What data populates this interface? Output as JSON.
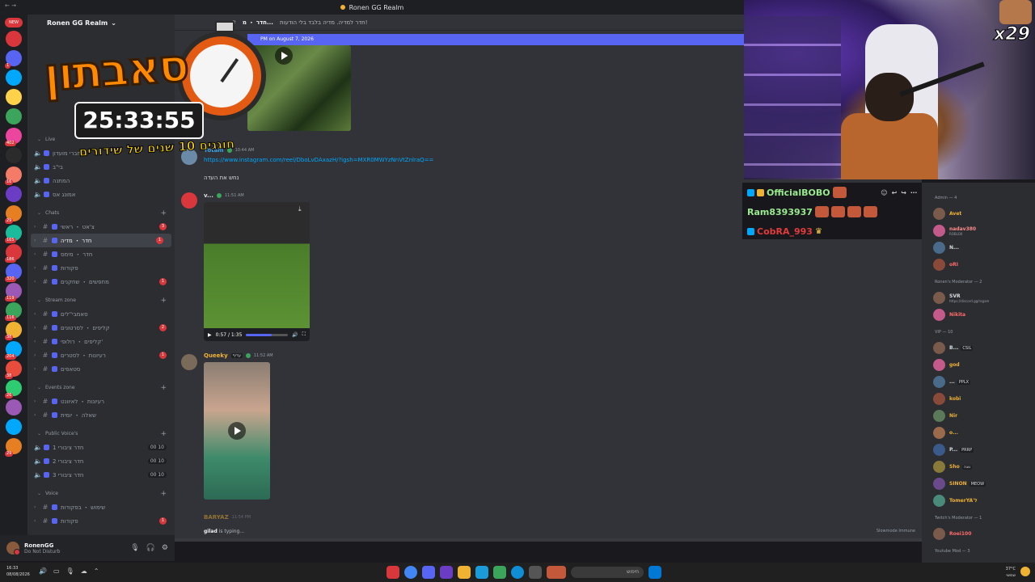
{
  "window": {
    "title": "Ronen GG Realm",
    "back_fwd": "← →"
  },
  "rail": {
    "new_label": "NEW",
    "servers": [
      {
        "color": "#da373c",
        "badge": ""
      },
      {
        "color": "#5865f2",
        "badge": "1"
      },
      {
        "color": "#00a8fc",
        "badge": ""
      },
      {
        "color": "#ffd24a",
        "badge": ""
      },
      {
        "color": "#3ba55c",
        "badge": ""
      },
      {
        "color": "#eb459e",
        "badge": "402"
      },
      {
        "color": "#2b2b2b",
        "badge": ""
      },
      {
        "color": "#f47b67",
        "badge": "16"
      },
      {
        "color": "#6a3dc4",
        "badge": ""
      },
      {
        "color": "#e67e22",
        "badge": "29"
      },
      {
        "color": "#1abc9c",
        "badge": "165"
      },
      {
        "color": "#da373c",
        "badge": "186"
      },
      {
        "color": "#5865f2",
        "badge": "320"
      },
      {
        "color": "#9b59b6",
        "badge": "119"
      },
      {
        "color": "#3ba55c",
        "badge": "116"
      },
      {
        "color": "#f0b232",
        "badge": "38"
      },
      {
        "color": "#00a8fc",
        "badge": "204"
      },
      {
        "color": "#e74c3c",
        "badge": "38"
      },
      {
        "color": "#2ecc71",
        "badge": "26"
      },
      {
        "color": "#9b59b6",
        "badge": ""
      },
      {
        "color": "#00a8fc",
        "badge": ""
      },
      {
        "color": "#e67e22",
        "badge": "29"
      }
    ]
  },
  "sidebar": {
    "guild_name": "Ronen GG Realm",
    "live_label": "Live",
    "channels_top": [
      {
        "label": "חברי מועדון",
        "voice": true
      },
      {
        "label": "בי\"ב",
        "voice": true
      },
      {
        "label": "המתנה",
        "voice": true
      },
      {
        "label": "אמונג אס",
        "voice": true
      }
    ],
    "cat_chats": "Chats",
    "channels_chats": [
      {
        "label": "צ'אט ・ ראשי",
        "badge": "3",
        "active": false
      },
      {
        "label": "חדר ・ מדיה",
        "badge": "1",
        "active": true
      },
      {
        "label": "חדר ・ מימס",
        "badge": "",
        "active": false
      },
      {
        "label": "פקודות",
        "badge": "",
        "active": false
      },
      {
        "label": "מחפשים ・ שחקנים",
        "badge": "1",
        "active": false
      }
    ],
    "cat_stream": "Stream zone",
    "channels_stream": [
      {
        "label": "סאמבי''לים",
        "badge": ""
      },
      {
        "label": "קליפים ・ לסרטונים",
        "badge": "2"
      },
      {
        "label": "קליפים ・ רולופי'",
        "badge": ""
      },
      {
        "label": "רעיונות ・ לסטרים",
        "badge": "1"
      },
      {
        "label": "סטאפים",
        "badge": ""
      }
    ],
    "cat_events": "Events zone",
    "channels_events": [
      {
        "label": "רעיונות ・ לאיוונט",
        "badge": ""
      },
      {
        "label": "שאלה ・ יומית",
        "badge": ""
      }
    ],
    "cat_public_voice": "Public Voice's",
    "channels_public_voice": [
      {
        "label": "חדר ציבורי 1",
        "count": "00 10"
      },
      {
        "label": "חדר ציבורי 2",
        "count": "00 10"
      },
      {
        "label": "חדר ציבורי 3",
        "count": "00 10"
      }
    ],
    "cat_voice": "Voice",
    "channels_voice": [
      {
        "label": "שימוש ・ בפקודות",
        "badge": ""
      },
      {
        "label": "פקודות",
        "badge": "1"
      }
    ]
  },
  "user_panel": {
    "name": "RonenGG",
    "status": "Do Not Disturb",
    "mic_icon": "🎙",
    "headset_icon": "🎧",
    "settings_icon": "⚙"
  },
  "overlay": {
    "title": "סאבתון",
    "timer": "25:33:55",
    "subtitle": "חוגגים 10 שנים של שידורים"
  },
  "chat": {
    "channel_name": "חדר ・ מ...",
    "topic": "חדר למדיה. מדיה בלבד בלי הודעות!",
    "new_messages_bar": "PM on August 7, 2026",
    "messages": [
      {
        "author": "Yotam",
        "color": "#3ba5e6",
        "time": "10:44 AM",
        "link": "https://www.instagram.com/reel/DboLvDAxazH/?igsh=MXR0MWYzNnVtZnlraQ==",
        "text": "נחש את העדה"
      },
      {
        "author": "v...",
        "color": "#dbdee1",
        "time": "11:51 AM",
        "video_time": "0:57 / 1:35",
        "video_progress": 0.6
      },
      {
        "author": "Queeky",
        "color": "#f0b232",
        "time": "11:52 AM",
        "tag": "עדיף"
      },
      {
        "author": "BARYAZ",
        "color": "#f0b232",
        "time": "11:54 PM"
      }
    ],
    "typing_user": "gilad",
    "typing_suffix": " is typing...",
    "slowmode": "Slowmode Immune",
    "composer_plus": "+"
  },
  "webcam": {
    "sub_multiplier": "x29"
  },
  "twitch_chat": {
    "rows": [
      {
        "user": "OfficialBOBO",
        "color": "#9aea8f"
      },
      {
        "user": "Ram8393937",
        "color": "#9aea8f"
      },
      {
        "user": "CobRA_993",
        "color": "#e33b3b"
      }
    ]
  },
  "members": {
    "cat_admin": "Admin — 4",
    "admins": [
      {
        "name": "Avet",
        "color": "#f0b232",
        "sub": ""
      },
      {
        "name": "nadav380",
        "color": "#ff8a8a",
        "sub": "ROBLOX"
      },
      {
        "name": "N...",
        "color": "#dbdee1",
        "sub": ""
      },
      {
        "name": "oRI",
        "color": "#ff6b6b",
        "sub": ""
      }
    ],
    "cat_mod": "Ronen's Moderator — 2",
    "mods": [
      {
        "name": "SVR",
        "color": "#dbdee1",
        "sub": "https://discord.gg/rogam"
      },
      {
        "name": "Nikita",
        "color": "#ff6b6b",
        "sub": ""
      }
    ],
    "cat_vip": "VIP — 10",
    "vips": [
      {
        "name": "B...",
        "color": "#dbdee1",
        "tag": "CSIL"
      },
      {
        "name": "god",
        "color": "#f0b232",
        "tag": ""
      },
      {
        "name": "...",
        "color": "#dbdee1",
        "tag": "PPLX"
      },
      {
        "name": "kobi",
        "color": "#f0b232",
        "tag": ""
      },
      {
        "name": "Nir",
        "color": "#f0b232",
        "tag": ""
      },
      {
        "name": "o...",
        "color": "#f0b232",
        "tag": ""
      },
      {
        "name": "P...",
        "color": "#dbdee1",
        "tag": "PRRP"
      },
      {
        "name": "Sho",
        "color": "#f0b232",
        "tag": "נוגה"
      },
      {
        "name": "SINON",
        "color": "#f0b232",
        "tag": "MEOW"
      },
      {
        "name": "TomerYA'ל",
        "color": "#f0b232",
        "tag": ""
      }
    ],
    "cat_twitch_mod": "Twitch's Moderator — 1",
    "twitch_mods": [
      {
        "name": "Roei100",
        "color": "#ff6b6b"
      }
    ],
    "cat_youtube": "Youtube Mod — 3"
  },
  "taskbar": {
    "time": "16:33",
    "date": "08/08/2026",
    "search_placeholder": "חיפוש",
    "weather_temp": "37°C",
    "weather_desc": "שמשי"
  }
}
